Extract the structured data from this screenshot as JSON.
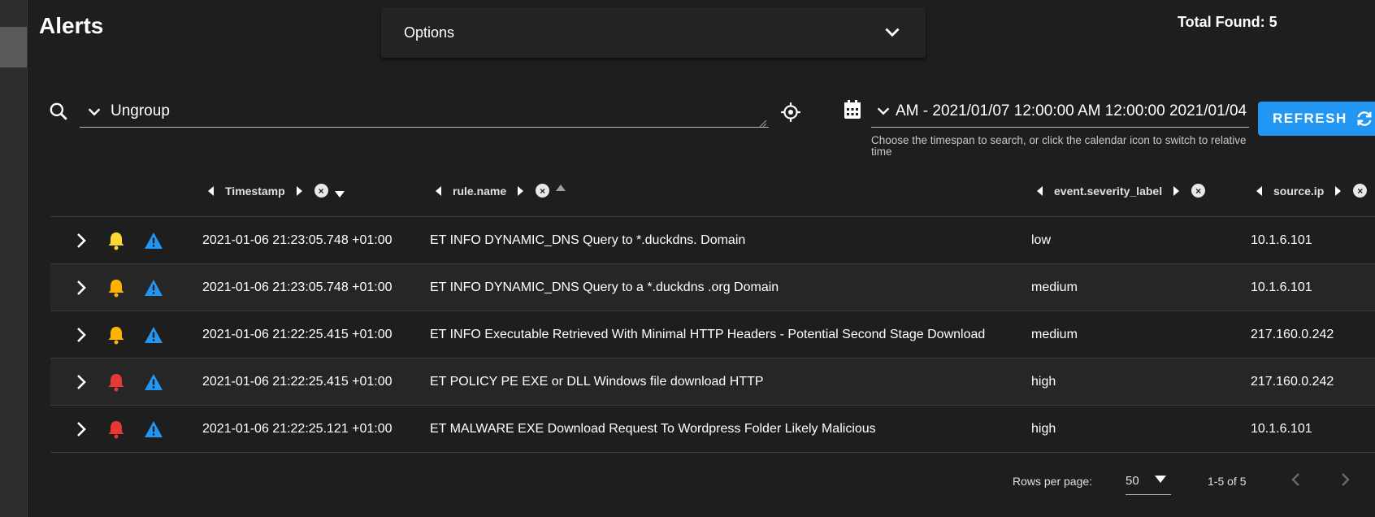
{
  "page": {
    "title": "Alerts",
    "total_found": "Total Found: 5"
  },
  "options": {
    "label": "Options"
  },
  "group": {
    "value": "Ungroup"
  },
  "daterange": {
    "value": "2021/01/04 12:00:00 AM - 2021/01/07 12:00:00 AM",
    "hint": "Choose the timespan to search, or click the calendar icon to switch to relative time"
  },
  "refresh": {
    "label": "REFRESH"
  },
  "columns": [
    {
      "label": "Timestamp",
      "sort": "desc"
    },
    {
      "label": "rule.name",
      "sort": "asc"
    },
    {
      "label": "event.severity_label",
      "sort": ""
    },
    {
      "label": "source.ip",
      "sort": ""
    }
  ],
  "rows": [
    {
      "timestamp": "2021-01-06 21:23:05.748 +01:00",
      "rule": "ET INFO DYNAMIC_DNS Query to *.duckdns. Domain",
      "severity": "low",
      "ip": "10.1.6.101",
      "bell_color": "#fdd835"
    },
    {
      "timestamp": "2021-01-06 21:23:05.748 +01:00",
      "rule": "ET INFO DYNAMIC_DNS Query to a *.duckdns .org Domain",
      "severity": "medium",
      "ip": "10.1.6.101",
      "bell_color": "#ffb300"
    },
    {
      "timestamp": "2021-01-06 21:22:25.415 +01:00",
      "rule": "ET INFO Executable Retrieved With Minimal HTTP Headers - Potential Second Stage Download",
      "severity": "medium",
      "ip": "217.160.0.242",
      "bell_color": "#ffb300"
    },
    {
      "timestamp": "2021-01-06 21:22:25.415 +01:00",
      "rule": "ET POLICY PE EXE or DLL Windows file download HTTP",
      "severity": "high",
      "ip": "217.160.0.242",
      "bell_color": "#e53935"
    },
    {
      "timestamp": "2021-01-06 21:22:25.121 +01:00",
      "rule": "ET MALWARE EXE Download Request To Wordpress Folder Likely Malicious",
      "severity": "high",
      "ip": "10.1.6.101",
      "bell_color": "#e53935"
    }
  ],
  "pagination": {
    "rows_per_page_label": "Rows per page:",
    "rows_per_page": "50",
    "range": "1-5 of 5"
  },
  "colors": {
    "accent": "#2196f3",
    "warning_icon": "#2196f3",
    "background": "#1e1e1e"
  },
  "icons": {
    "search": "search-icon",
    "expand": "chevron-right-icon",
    "alert": "bell-icon",
    "escalate": "warning-triangle-icon",
    "calendar": "calendar-icon",
    "refresh": "refresh-icon",
    "target": "crosshair-icon"
  }
}
